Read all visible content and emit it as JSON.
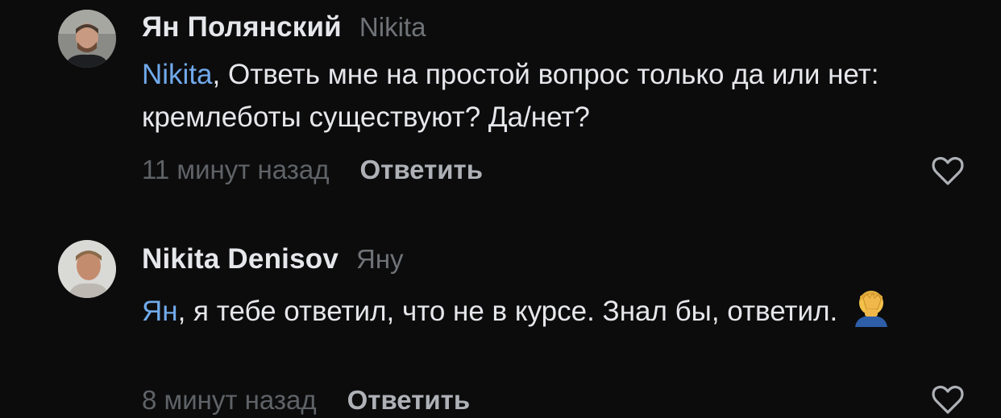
{
  "comments": [
    {
      "author": "Ян Полянский",
      "reply_to": "Nikita",
      "mention": "Nikita",
      "text_after_mention": ", Ответь мне на простой вопрос только да или нет: кремлеботы существуют? Да/нет?",
      "time": "11 минут назад",
      "reply_label": "Ответить",
      "like_icon": "heart-outline-icon"
    },
    {
      "author": "Nikita Denisov",
      "reply_to": "Яну",
      "mention": "Ян",
      "text_after_mention": ", я тебе ответил, что не в курсе. Знал бы, ответил.",
      "emoji": "facepalm-emoji",
      "time": "8 минут назад",
      "reply_label": "Ответить",
      "like_icon": "heart-outline-icon"
    }
  ],
  "colors": {
    "background": "#0c0c0d",
    "text": "#e6e7eb",
    "mention": "#71aaeb",
    "muted": "#6f7377",
    "reply_button": "#aeb1b6"
  }
}
